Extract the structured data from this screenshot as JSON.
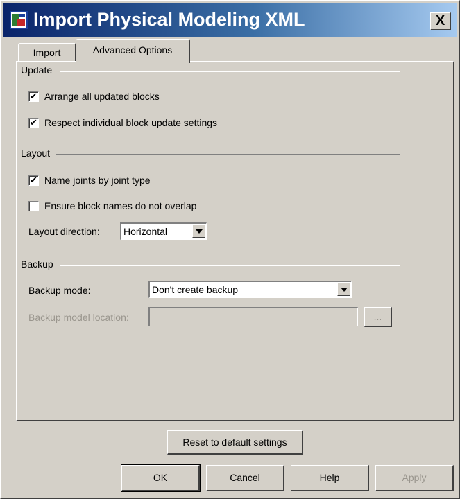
{
  "window": {
    "title": "Import Physical Modeling XML",
    "close_label": "X"
  },
  "tabs": [
    {
      "label": "Import",
      "selected": false
    },
    {
      "label": "Advanced Options",
      "selected": true
    }
  ],
  "update": {
    "group_title": "Update",
    "arrange_all_label": "Arrange all updated blocks",
    "arrange_all_checked": true,
    "respect_settings_label": "Respect individual block update settings",
    "respect_settings_checked": true
  },
  "layout": {
    "group_title": "Layout",
    "name_joints_label": "Name joints by joint type",
    "name_joints_checked": true,
    "ensure_names_label": "Ensure block names do not overlap",
    "ensure_names_checked": false,
    "direction_label": "Layout direction:",
    "direction_value": "Horizontal"
  },
  "backup": {
    "group_title": "Backup",
    "mode_label": "Backup mode:",
    "mode_value": "Don't create backup",
    "location_label": "Backup model location:",
    "location_value": "",
    "browse_label": "..."
  },
  "reset_label": "Reset to default settings",
  "footer": {
    "ok_label": "OK",
    "cancel_label": "Cancel",
    "help_label": "Help",
    "apply_label": "Apply"
  },
  "check_glyph": "✔"
}
